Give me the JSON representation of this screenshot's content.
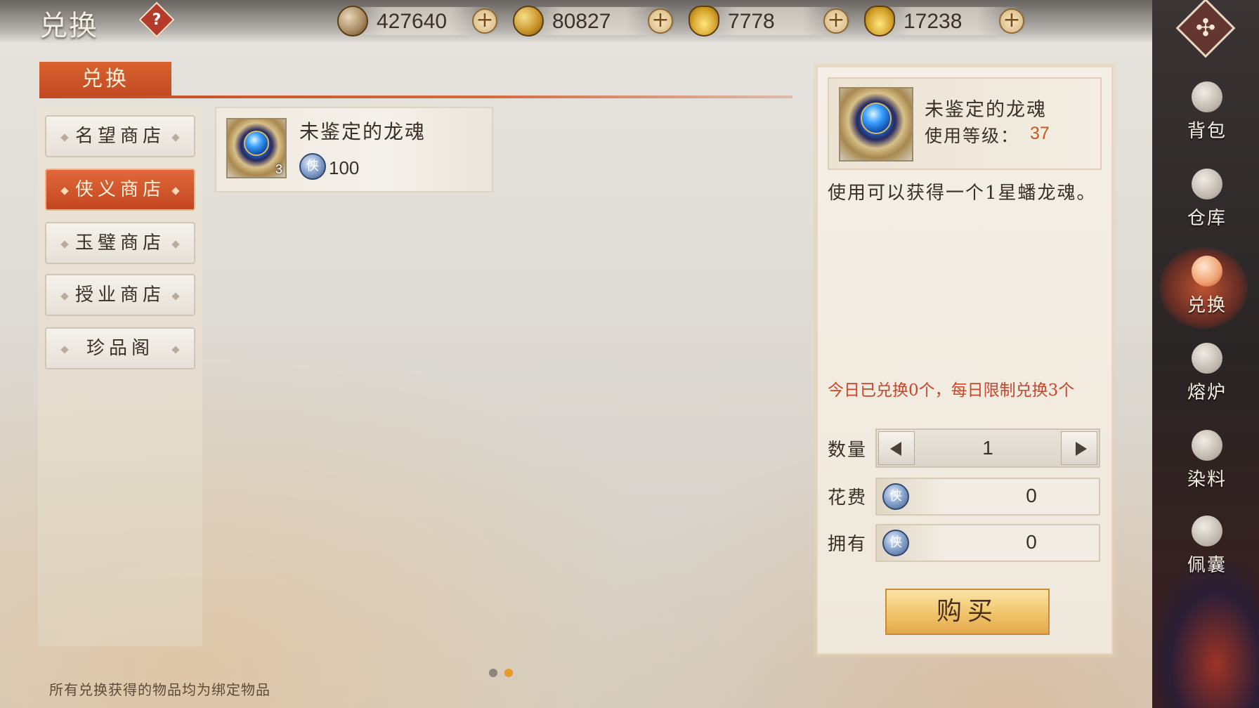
{
  "header": {
    "title": "兑换",
    "help_icon": "?",
    "corner_icon": "✣"
  },
  "currencies": [
    {
      "icon": "copper-coin-icon",
      "value": "427640",
      "plus": "+"
    },
    {
      "icon": "gold-coin-icon",
      "value": "80827",
      "plus": "+"
    },
    {
      "icon": "bound-ingot-icon",
      "value": "7778",
      "plus": "+"
    },
    {
      "icon": "gold-ingot-icon",
      "value": "17238",
      "plus": "+"
    }
  ],
  "tab": {
    "label": "兑换"
  },
  "shops": [
    {
      "label": "名望商店",
      "active": false
    },
    {
      "label": "侠义商店",
      "active": true
    },
    {
      "label": "玉璧商店",
      "active": false
    },
    {
      "label": "授业商店",
      "active": false
    },
    {
      "label": "珍品阁",
      "active": false
    }
  ],
  "items": [
    {
      "name": "未鉴定的龙魂",
      "price": "100",
      "count": "3",
      "token": "侠"
    }
  ],
  "pagination": {
    "pages": 2,
    "current": 2
  },
  "footer_note": "所有兑换获得的物品均为绑定物品",
  "detail": {
    "name": "未鉴定的龙魂",
    "level_label": "使用等级：",
    "level": "37",
    "description": "使用可以获得一个1星蟠龙魂。",
    "limit_text": "今日已兑换0个，每日限制兑换3个",
    "quantity_label": "数量",
    "quantity": "1",
    "cost_label": "花费",
    "cost": "0",
    "own_label": "拥有",
    "own": "0",
    "token": "侠",
    "buy_label": "购买"
  },
  "sidebar": [
    {
      "label": "背包",
      "icon": "backpack-icon",
      "active": false
    },
    {
      "label": "仓库",
      "icon": "warehouse-icon",
      "active": false
    },
    {
      "label": "兑换",
      "icon": "exchange-icon",
      "active": true
    },
    {
      "label": "熔炉",
      "icon": "furnace-icon",
      "active": false
    },
    {
      "label": "染料",
      "icon": "dye-icon",
      "active": false
    },
    {
      "label": "佩囊",
      "icon": "pouch-icon",
      "active": false
    }
  ],
  "colors": {
    "accent": "#c94a22",
    "level": "#c9571f",
    "limit": "#c9462a",
    "buy": "#f1c46a"
  }
}
